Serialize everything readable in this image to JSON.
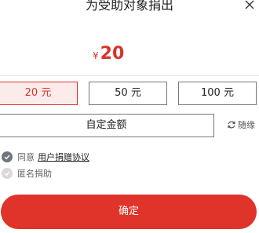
{
  "dialog": {
    "title": "为受助对象捐出",
    "close_icon": "close-icon"
  },
  "amount": {
    "currency": "¥",
    "value": "20"
  },
  "presets": [
    {
      "label": "20 元",
      "selected": true
    },
    {
      "label": "50 元",
      "selected": false
    },
    {
      "label": "100 元",
      "selected": false
    }
  ],
  "custom_amount": {
    "label": "自定金额"
  },
  "random": {
    "icon": "refresh-icon",
    "label": "随缘"
  },
  "agreement": {
    "checked": true,
    "prefix": "同意",
    "link": "用户捐赠协议"
  },
  "anonymous": {
    "checked": false,
    "label": "匿名捐助"
  },
  "confirm_button": {
    "label": "确定"
  },
  "colors": {
    "accent": "#e0342a",
    "selected_bg": "#fbeceb",
    "check_on": "#6f7680",
    "check_off": "#d9d9d9"
  }
}
